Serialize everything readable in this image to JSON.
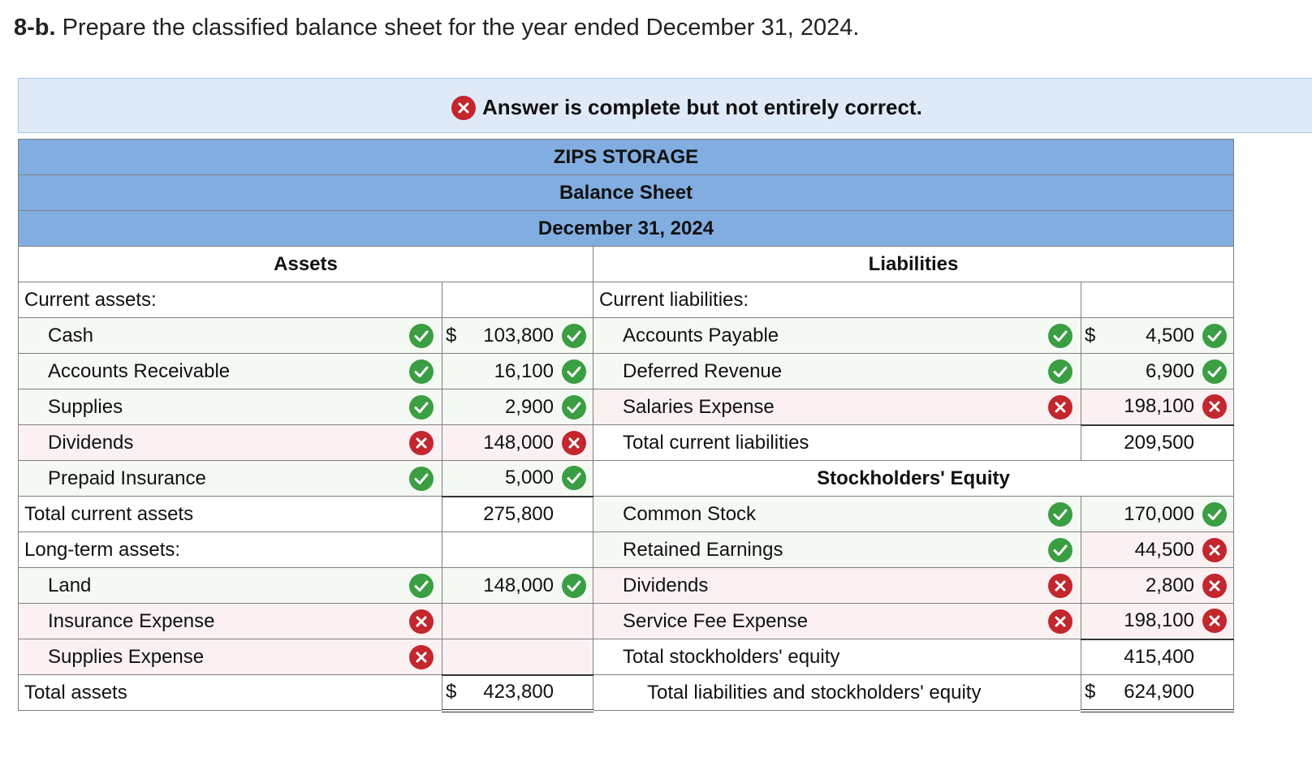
{
  "question": {
    "number": "8-b.",
    "text": "Prepare the classified balance sheet for the year ended December 31, 2024."
  },
  "banner": {
    "text": "Answer is complete but not entirely correct."
  },
  "header": {
    "company": "ZIPS STORAGE",
    "statement": "Balance Sheet",
    "date": "December 31, 2024"
  },
  "columns": {
    "assets": "Assets",
    "liabilities": "Liabilities"
  },
  "assets": {
    "current_heading": "Current assets:",
    "current": [
      {
        "label": "Cash",
        "dollar": "$",
        "amount": "103,800",
        "label_status": "correct",
        "amount_status": "correct"
      },
      {
        "label": "Accounts Receivable",
        "dollar": "",
        "amount": "16,100",
        "label_status": "correct",
        "amount_status": "correct"
      },
      {
        "label": "Supplies",
        "dollar": "",
        "amount": "2,900",
        "label_status": "correct",
        "amount_status": "correct"
      },
      {
        "label": "Dividends",
        "dollar": "",
        "amount": "148,000",
        "label_status": "incorrect",
        "amount_status": "incorrect"
      },
      {
        "label": "Prepaid Insurance",
        "dollar": "",
        "amount": "5,000",
        "label_status": "correct",
        "amount_status": "correct"
      }
    ],
    "total_current_label": "Total current assets",
    "total_current": "275,800",
    "long_term_heading": "Long-term assets:",
    "long_term": [
      {
        "label": "Land",
        "amount": "148,000",
        "label_status": "correct",
        "amount_status": "correct"
      },
      {
        "label": "Insurance Expense",
        "amount": "",
        "label_status": "incorrect",
        "amount_status": ""
      },
      {
        "label": "Supplies Expense",
        "amount": "",
        "label_status": "incorrect",
        "amount_status": ""
      }
    ],
    "total_label": "Total assets",
    "total_dollar": "$",
    "total": "423,800"
  },
  "liabilities": {
    "current_heading": "Current liabilities:",
    "current": [
      {
        "label": "Accounts Payable",
        "dollar": "$",
        "amount": "4,500",
        "label_status": "correct",
        "amount_status": "correct"
      },
      {
        "label": "Deferred Revenue",
        "dollar": "",
        "amount": "6,900",
        "label_status": "correct",
        "amount_status": "correct"
      },
      {
        "label": "Salaries Expense",
        "dollar": "",
        "amount": "198,100",
        "label_status": "incorrect",
        "amount_status": "incorrect"
      }
    ],
    "total_current_label": "Total current liabilities",
    "total_current": "209,500",
    "equity_heading": "Stockholders' Equity",
    "equity": [
      {
        "label": "Common Stock",
        "amount": "170,000",
        "label_status": "correct",
        "amount_status": "correct"
      },
      {
        "label": "Retained Earnings",
        "amount": "44,500",
        "label_status": "correct",
        "amount_status": "incorrect"
      },
      {
        "label": "Dividends",
        "amount": "2,800",
        "label_status": "incorrect",
        "amount_status": "incorrect"
      },
      {
        "label": "Service Fee Expense",
        "amount": "198,100",
        "label_status": "incorrect",
        "amount_status": "incorrect"
      }
    ],
    "total_equity_label": "Total stockholders' equity",
    "total_equity": "415,400",
    "total_le_label": "Total liabilities and stockholders' equity",
    "total_le_dollar": "$",
    "total_le": "624,900"
  },
  "colors": {
    "header_blue": "#82ade0",
    "banner_bg": "#deeaf7",
    "correct_green": "#3a9e43",
    "incorrect_red": "#c3262d"
  }
}
